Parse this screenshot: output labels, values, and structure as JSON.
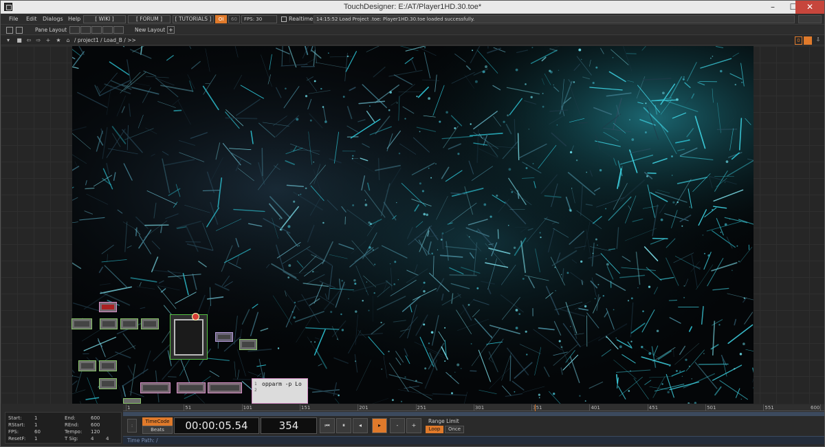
{
  "window": {
    "title": "TouchDesigner: E:/AT/Player1HD.30.toe*"
  },
  "menubar": {
    "items": [
      "File",
      "Edit",
      "Dialogs",
      "Help"
    ],
    "wiki": "[ WIKI ]",
    "forum": "[ FORUM ]",
    "tutorials": "[ TUTORIALS ]",
    "oi": "OI",
    "sixty": "60",
    "fps": "FPS:  30",
    "realtime": "Realtime",
    "status": "14:15:52 Load Project .toe: Player1HD.30.toe loaded successfully."
  },
  "panebar": {
    "pane_layout": "Pane Layout",
    "new_layout": "New Layout",
    "plus": "+"
  },
  "pathbar": {
    "path": "/ project1 / Load_B / >>",
    "zero": "0"
  },
  "network": {
    "script_node": {
      "line1": "1",
      "line2": "2",
      "code": "opparm -p Lo"
    }
  },
  "timeline": {
    "ticks": [
      "1",
      "51",
      "101",
      "151",
      "201",
      "251",
      "301",
      "351",
      "401",
      "451",
      "501",
      "551",
      "600"
    ],
    "playhead_frame": 354
  },
  "info": {
    "start_label": "Start:",
    "start": "1",
    "end_label": "End:",
    "end": "600",
    "rstart_label": "RStart:",
    "rstart": "1",
    "rend_label": "REnd:",
    "rend": "600",
    "fps_label": "FPS:",
    "fps": "60",
    "tempo_label": "Tempo:",
    "tempo": "120",
    "resetf_label": "ResetF:",
    "resetf": "1",
    "tsig_label": "T Sig:",
    "tsig1": "4",
    "tsig2": "4"
  },
  "transport": {
    "timecode": "TimeCode",
    "beats": "Beats",
    "colon": ":",
    "time": "00:00:05.54",
    "frame": "354",
    "range_limit": "Range Limit",
    "loop": "Loop",
    "once": "Once",
    "buttons": {
      "rewind": "⏮",
      "pause": "⏸",
      "step_back": "◂",
      "play": "▸",
      "minus": "-",
      "plus": "+"
    }
  },
  "timepath": {
    "label": "Time Path: /"
  },
  "colors": {
    "accent": "#e07a2b",
    "selection": "#56c243",
    "viewer_tint": "#3fd6e6"
  }
}
